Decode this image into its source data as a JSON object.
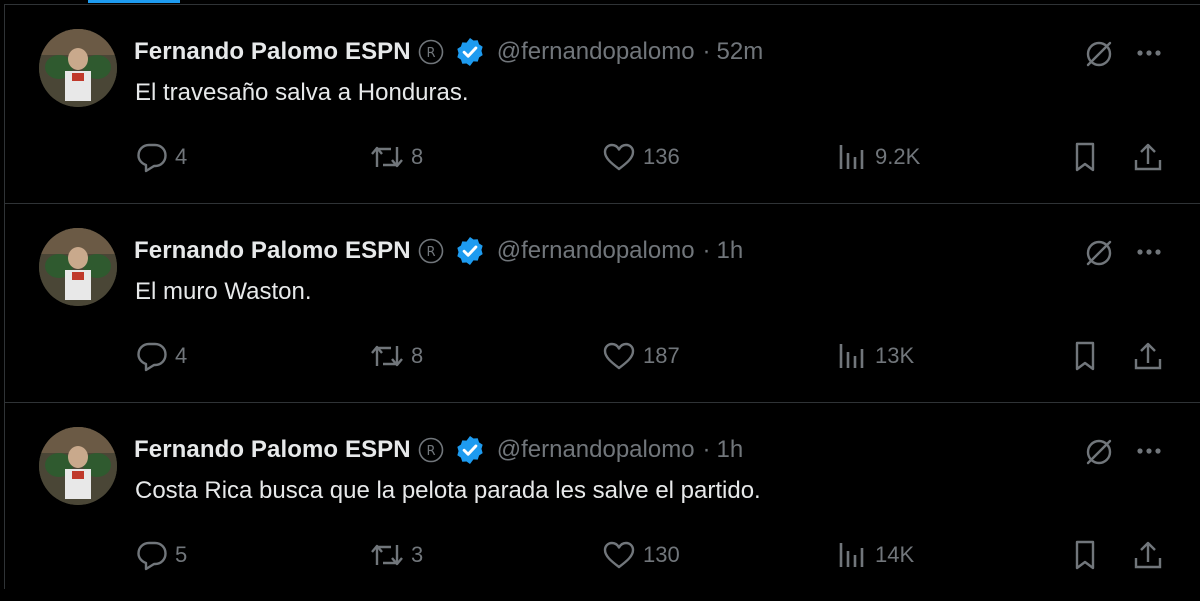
{
  "tweets": [
    {
      "author_name": "Fernando Palomo ESPN",
      "handle": "@fernandopalomo",
      "separator": "·",
      "time": "52m",
      "text": "El travesaño salva a Honduras.",
      "replies": "4",
      "retweets": "8",
      "likes": "136",
      "views": "9.2K"
    },
    {
      "author_name": "Fernando Palomo ESPN",
      "handle": "@fernandopalomo",
      "separator": "·",
      "time": "1h",
      "text": "El muro Waston.",
      "replies": "4",
      "retweets": "8",
      "likes": "187",
      "views": "13K"
    },
    {
      "author_name": "Fernando Palomo ESPN",
      "handle": "@fernandopalomo",
      "separator": "·",
      "time": "1h",
      "text": "Costa Rica busca que la pelota parada les salve el partido.",
      "replies": "5",
      "retweets": "3",
      "likes": "130",
      "views": "14K"
    }
  ],
  "icons": {
    "registered": "registered-mark-icon",
    "verified": "verified-badge-icon",
    "grok": "grok-icon",
    "more": "more-options-icon",
    "reply": "reply-icon",
    "retweet": "retweet-icon",
    "like": "heart-icon",
    "views": "views-chart-icon",
    "bookmark": "bookmark-icon",
    "share": "share-icon"
  },
  "colors": {
    "background": "#000000",
    "text_primary": "#e7e9ea",
    "text_secondary": "#71767b",
    "verified_blue": "#1d9bf0",
    "divider": "#2f3336"
  }
}
